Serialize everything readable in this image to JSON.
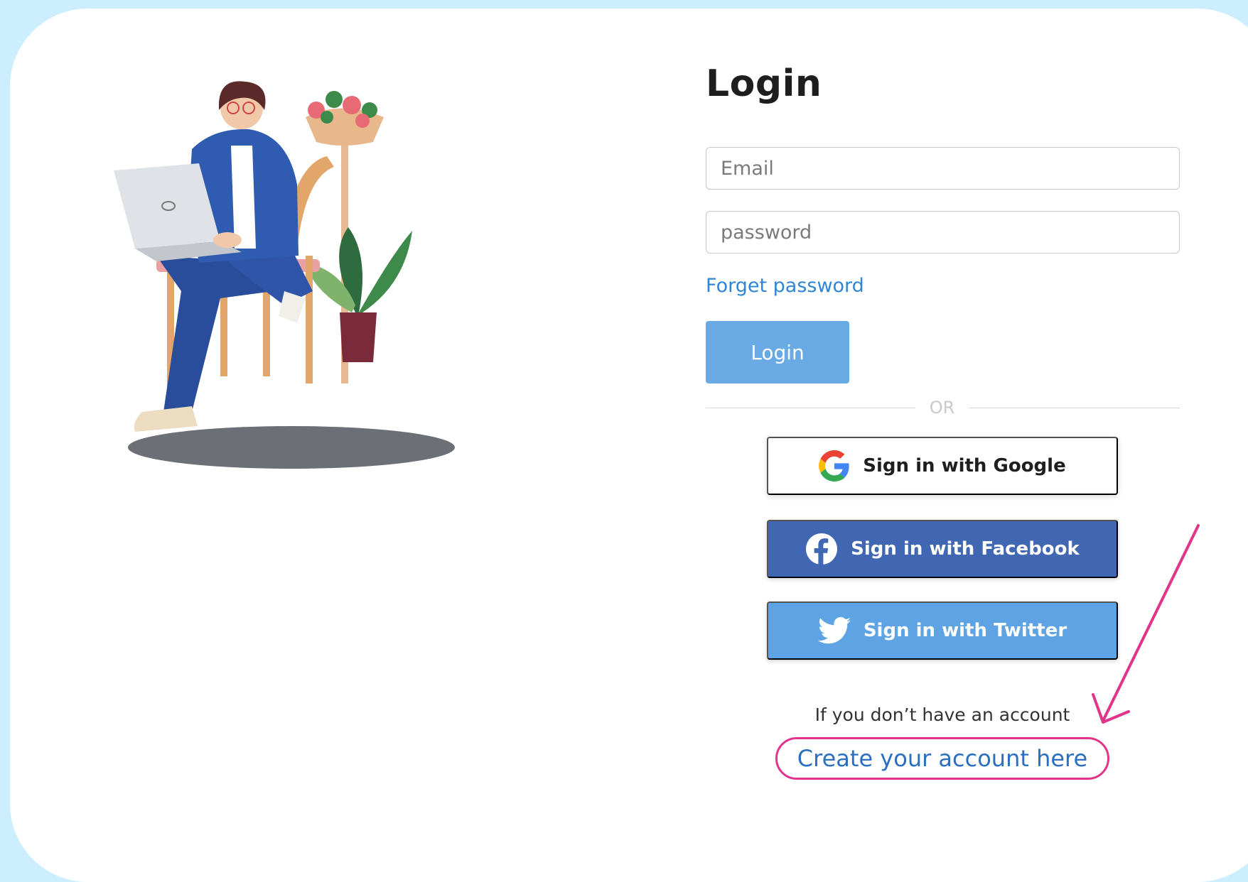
{
  "login": {
    "title": "Login",
    "email_placeholder": "Email",
    "password_placeholder": "password",
    "forget_password": "Forget password",
    "login_button": "Login",
    "divider": "OR"
  },
  "social": {
    "google": "Sign in with Google",
    "facebook": "Sign in with Facebook",
    "twitter": "Sign in with Twitter"
  },
  "signup": {
    "prompt": "If you don’t have an account",
    "link": "Create your account here"
  },
  "icons": {
    "google": "google-icon",
    "facebook": "facebook-icon",
    "twitter": "twitter-icon",
    "annotation": "arrow-annotation"
  },
  "colors": {
    "page_background": "#cdeefe",
    "link": "#2f86d6",
    "login_button": "#6aaae4",
    "facebook": "#4267b2",
    "twitter": "#5ea4e4",
    "annotation": "#e0358a"
  }
}
